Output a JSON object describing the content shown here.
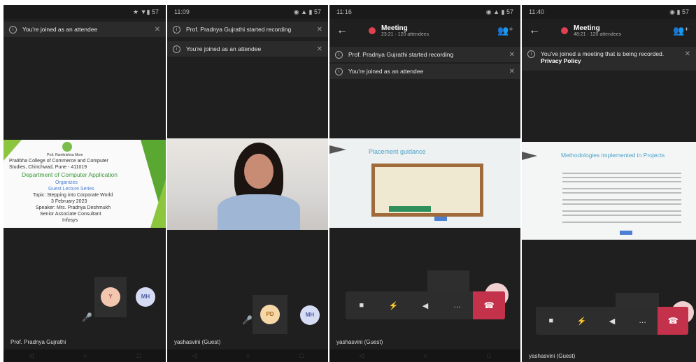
{
  "panels": [
    {
      "statusbar": {
        "left": "",
        "right": "★ ▼▮ 57"
      },
      "banners": [
        "You're joined as an attendee"
      ],
      "slide": {
        "org": "Prof. Ramkrishna More",
        "college": "Pratibha College of Commerce and Computer",
        "address": "Studies, Chinchwad, Pune - 411019",
        "dept": "Department of Computer Application",
        "organizes": "Organizes",
        "event": "Guest Lecture Series",
        "topic": "Topic: Stepping into Corporate World",
        "date": "3 February 2023",
        "speaker": "Speaker: Mrs. Pradnya Deshmukh",
        "role": "Senior Associate Consultant",
        "company": "Infosys"
      },
      "avatars": [
        "Y",
        "MH"
      ],
      "bottom_name": "Prof. Pradnya Gujrathi"
    },
    {
      "statusbar": {
        "left": "11:09",
        "right": "◉ ▲ ▮ 57"
      },
      "banners": [
        "Prof. Pradnya Gujrathi started recording",
        "You're joined as an attendee"
      ],
      "avatars": [
        "PD",
        "MH"
      ],
      "bottom_name": "yashasvini (Guest)"
    },
    {
      "statusbar": {
        "left": "11:16",
        "right": "◉ ▲ ▮ 57"
      },
      "meeting": {
        "title": "Meeting",
        "sub": "23:21 · 120 attendees"
      },
      "banners": [
        "Prof. Pradnya Gujrathi started recording",
        "You're joined as an attendee"
      ],
      "slide_title": "Placement guidance",
      "controls": [
        "■",
        "⚡",
        "◀",
        "…",
        "☎"
      ],
      "bottom_name": "yashasvini (Guest)"
    },
    {
      "statusbar": {
        "left": "11:40",
        "right": "◉ ▮ 57"
      },
      "meeting": {
        "title": "Meeting",
        "sub": "48:21 · 120 attendees"
      },
      "banners": [
        "You've joined a meeting that is being recorded."
      ],
      "banner_link": "Privacy Policy",
      "slide_title": "Methodologies implemented in Projects",
      "controls": [
        "■",
        "⚡",
        "◀",
        "…",
        "☎"
      ],
      "bottom_name": "yashasvini (Guest)"
    }
  ],
  "colors": {
    "hangup": "#c4314b",
    "accent": "#4a7fd4",
    "slide_green": "#5aa832",
    "record": "#e04050"
  },
  "icons": {
    "people": "people-add-icon",
    "back": "back-arrow-icon",
    "info": "info-icon"
  }
}
